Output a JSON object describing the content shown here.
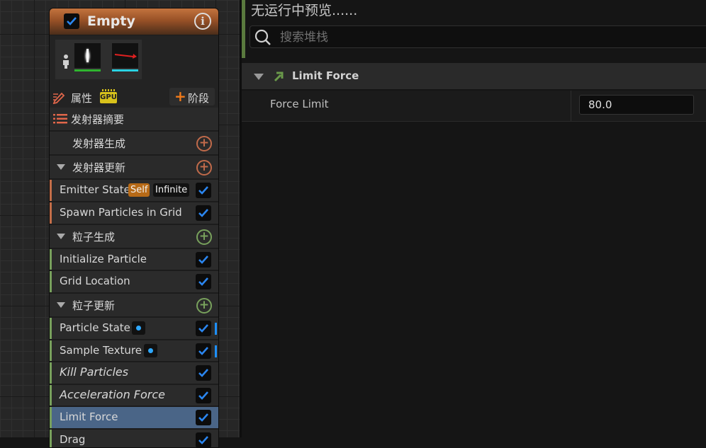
{
  "node": {
    "title": "Empty",
    "enabled": true,
    "properties_label": "属性",
    "gpu_badge": "GPU",
    "stage_label": "阶段",
    "summary_label": "发射器摘要",
    "sections": {
      "emitter_spawn": "发射器生成",
      "emitter_update": "发射器更新",
      "particle_spawn": "粒子生成",
      "particle_update": "粒子更新"
    },
    "modules": {
      "emitter_state": {
        "label": "Emitter State",
        "badge_self": "Self",
        "badge_infinite": "Infinite"
      },
      "spawn_grid": {
        "label": "Spawn Particles in Grid"
      },
      "initialize_particle": {
        "label": "Initialize Particle"
      },
      "grid_location": {
        "label": "Grid Location"
      },
      "particle_state": {
        "label": "Particle State"
      },
      "sample_texture": {
        "label": "Sample Texture"
      },
      "kill_particles": {
        "label": "Kill Particles"
      },
      "acceleration_force": {
        "label": "Acceleration Force"
      },
      "limit_force": {
        "label": "Limit Force"
      },
      "drag": {
        "label": "Drag"
      }
    },
    "colors": {
      "header": "#985127",
      "emitter_bar": "#c46e48",
      "particle_bar": "#78a15c",
      "selected": "#4a6587",
      "checkbox": "#2b86f0"
    }
  },
  "panel": {
    "preview_text": "无运行中预览......",
    "search_placeholder": "搜索堆栈",
    "category_label": "Limit Force",
    "param_label": "Force Limit",
    "param_value": "80.0"
  }
}
